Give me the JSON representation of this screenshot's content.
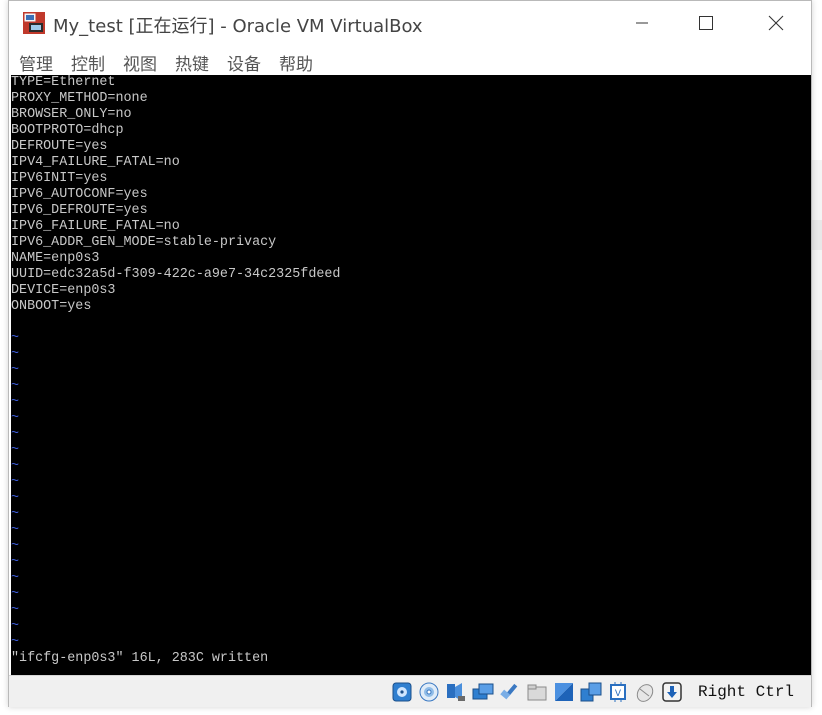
{
  "window": {
    "title": "My_test [正在运行] - Oracle VM VirtualBox",
    "controls": [
      "minimize",
      "maximize",
      "close"
    ]
  },
  "menu": {
    "items": [
      {
        "label": "管理"
      },
      {
        "label": "控制"
      },
      {
        "label": "视图"
      },
      {
        "label": "热键"
      },
      {
        "label": "设备"
      },
      {
        "label": "帮助"
      }
    ]
  },
  "console": {
    "lines": [
      "TYPE=Ethernet",
      "PROXY_METHOD=none",
      "BROWSER_ONLY=no",
      "BOOTPROTO=dhcp",
      "DEFROUTE=yes",
      "IPV4_FAILURE_FATAL=no",
      "IPV6INIT=yes",
      "IPV6_AUTOCONF=yes",
      "IPV6_DEFROUTE=yes",
      "IPV6_FAILURE_FATAL=no",
      "IPV6_ADDR_GEN_MODE=stable-privacy",
      "NAME=enp0s3",
      "UUID=edc32a5d-f309-422c-a9e7-34c2325fdeed",
      "DEVICE=enp0s3",
      "ONBOOT=yes"
    ],
    "tilde": "~",
    "status": "\"ifcfg-enp0s3\" 16L, 283C written"
  },
  "statusbar": {
    "icons": [
      "hard-disk-icon",
      "optical-drive-icon",
      "audio-icon",
      "network-icon",
      "usb-icon",
      "shared-folders-icon",
      "display-icon",
      "video-capture-icon",
      "cpu-icon",
      "mouse-integration-icon",
      "keyboard-capture-icon"
    ],
    "host_key": "Right Ctrl"
  },
  "colors": {
    "console_bg": "#000000",
    "console_text": "#c8c8c8",
    "tilde": "#3d5bd6",
    "statusbar_bg": "#f0f0f0"
  }
}
